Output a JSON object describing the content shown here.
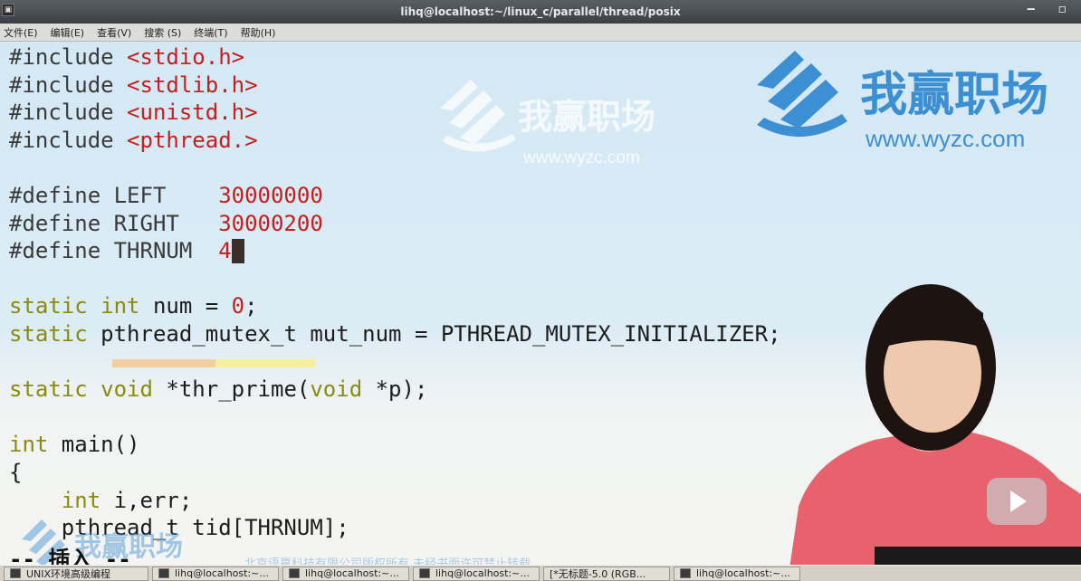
{
  "window": {
    "title": "lihq@localhost:~/linux_c/parallel/thread/posix"
  },
  "menu": [
    "文件(E)",
    "编辑(E)",
    "查看(V)",
    "搜索 (S)",
    "终端(T)",
    "帮助(H)"
  ],
  "code": {
    "lines": [
      [
        {
          "t": "#include ",
          "c": "kw-pre"
        },
        {
          "t": "<stdio.h>",
          "c": "str"
        }
      ],
      [
        {
          "t": "#include ",
          "c": "kw-pre"
        },
        {
          "t": "<stdlib.h>",
          "c": "str"
        }
      ],
      [
        {
          "t": "#include ",
          "c": "kw-pre"
        },
        {
          "t": "<unistd.h>",
          "c": "str"
        }
      ],
      [
        {
          "t": "#include ",
          "c": "kw-pre"
        },
        {
          "t": "<pthread.>",
          "c": "str"
        }
      ],
      [],
      [
        {
          "t": "#define LEFT    ",
          "c": "kw-pre"
        },
        {
          "t": "30000000",
          "c": "num"
        }
      ],
      [
        {
          "t": "#define RIGHT   ",
          "c": "kw-pre"
        },
        {
          "t": "30000200",
          "c": "num"
        }
      ],
      [
        {
          "t": "#define THRNUM  ",
          "c": "kw-pre"
        },
        {
          "t": "4",
          "c": "num"
        },
        {
          "cursor": true
        }
      ],
      [],
      [
        {
          "t": "static ",
          "c": "kw"
        },
        {
          "t": "int ",
          "c": "kw"
        },
        {
          "t": "num = ",
          "c": "plain"
        },
        {
          "t": "0",
          "c": "num"
        },
        {
          "t": ";",
          "c": "plain"
        }
      ],
      [
        {
          "t": "static ",
          "c": "kw"
        },
        {
          "t": "pthread_mutex_t mut_num = PTHREAD_MUTEX_INITIALIZER;",
          "c": "plain"
        }
      ],
      [],
      [
        {
          "t": "static ",
          "c": "kw"
        },
        {
          "t": "void ",
          "c": "kw"
        },
        {
          "t": "*thr_prime(",
          "c": "plain"
        },
        {
          "t": "void ",
          "c": "kw"
        },
        {
          "t": "*p);",
          "c": "plain"
        }
      ],
      [],
      [
        {
          "t": "int ",
          "c": "kw"
        },
        {
          "t": "main()",
          "c": "plain"
        }
      ],
      [
        {
          "t": "{",
          "c": "plain"
        }
      ],
      [
        {
          "t": "    ",
          "c": "plain"
        },
        {
          "t": "int ",
          "c": "kw"
        },
        {
          "t": "i,err;",
          "c": "plain"
        }
      ],
      [
        {
          "t": "    pthread_t tid[THRNUM];",
          "c": "plain"
        }
      ]
    ],
    "mode": "-- 插入 --"
  },
  "watermark": {
    "brand": "我赢职场",
    "url": "www.wyzc.com",
    "copyright": "北京语赢科技有限公司版权所有  未经书面许可禁止转载"
  },
  "taskbar": {
    "items": [
      "UNIX环境高级编程",
      "lihq@localhost:~...",
      "lihq@localhost:~...",
      "lihq@localhost:~...",
      "[*无标题-5.0 (RGB...",
      "lihq@localhost:~..."
    ]
  },
  "colors": {
    "string": "#c41e1e",
    "keyword": "#8a8a10",
    "preprocessor": "#3a3a3a",
    "brand": "#3d8fd3"
  },
  "icons": [
    "terminal-icon",
    "wyzc-logo",
    "play-icon"
  ]
}
